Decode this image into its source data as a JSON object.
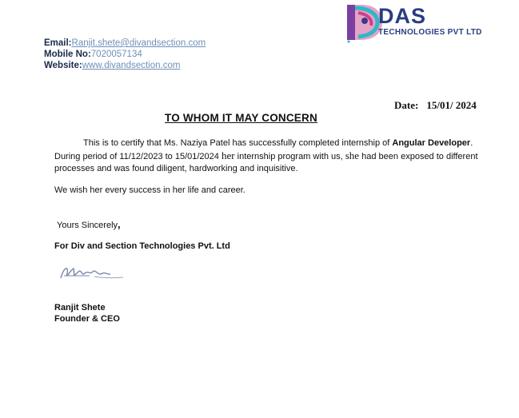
{
  "contact": {
    "email_label": "Email:",
    "email_value": "Ranjit.shete@divandsection.com",
    "mobile_label": "Mobile No:",
    "mobile_value": "7020057134",
    "website_label": "Website:",
    "website_value": "www.divandsection.com"
  },
  "logo": {
    "name": "DAS",
    "subtitle": "TECHNOLOGIES PVT LTD",
    "colors": {
      "primary": "#2a3d82",
      "accent_pink": "#d0408a",
      "accent_teal": "#2eb8c8"
    }
  },
  "date": {
    "label": "Date:",
    "value": "15/01/ 2024"
  },
  "heading": "TO WHOM IT MAY CONCERN",
  "body": {
    "p1_part1": "This is to certify that Ms. Naziya Patel has successfully completed internship of ",
    "role": "Angular Developer",
    "p1_part2": ".",
    "p2_part1": "During period of 11/12/2023 to 15/01/2024 ",
    "her": "her",
    "p2_part2": " internship program with us, ",
    "she": "she",
    "p2_part3": " had been exposed to different processes and was found diligent, hardworking and inquisitive."
  },
  "wish": "We wish her every success in her life and career.",
  "closing": {
    "text": "Yours Sincerely",
    "comma": ","
  },
  "company": "For Div and Section Technologies Pvt. Ltd",
  "signer": {
    "name": "Ranjit Shete",
    "title": "Founder & CEO"
  }
}
